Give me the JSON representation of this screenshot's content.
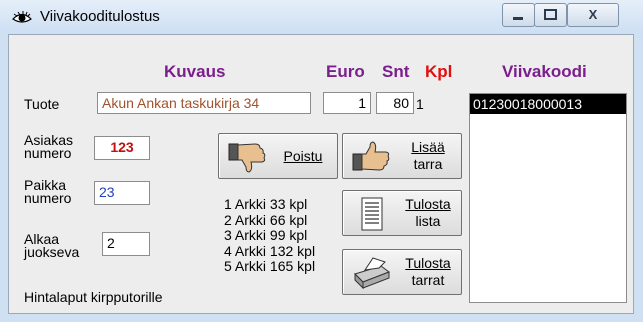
{
  "window": {
    "title": "Viivakooditulostus",
    "minimize_symbol": "▭",
    "maximize_symbol": "▢",
    "close_symbol": "X"
  },
  "headers": {
    "kuvaus": "Kuvaus",
    "euro": "Euro",
    "snt": "Snt",
    "kpl": "Kpl",
    "viivakoodi": "Viivakoodi"
  },
  "form": {
    "tuote_label": "Tuote",
    "tuote_value": "Akun Ankan taskukirja 34",
    "euro_value": "1",
    "snt_value": "80",
    "kpl_value": "1",
    "asiakas_label_1": "Asiakas",
    "asiakas_label_2": "numero",
    "asiakas_value": "123",
    "paikka_label_1": "Paikka",
    "paikka_label_2": "numero",
    "paikka_value": "23",
    "alkaa_label_1": "Alkaa",
    "alkaa_label_2": "juokseva",
    "alkaa_value": "2",
    "footer_text": "Hintalaput kirpputorille"
  },
  "buttons": {
    "poistu": "Poistu",
    "lisaa_1": "Lisää",
    "lisaa_2": "tarra",
    "tulosta_lista_1": "Tulosta",
    "tulosta_lista_2": "lista",
    "tulosta_tarrat_1": "Tulosta",
    "tulosta_tarrat_2": "tarrat"
  },
  "sheets": [
    "1 Arkki 33 kpl",
    "2 Arkki 66 kpl",
    "3 Arkki 99 kpl",
    "4 Arkki 132 kpl",
    "5 Arkki 165 kpl"
  ],
  "barcodes": [
    "01230018000013"
  ],
  "colors": {
    "header_purple": "#7a1f8c",
    "kpl_red": "#e01010",
    "asiakas_red": "#c01010",
    "paikka_blue": "#2040c0",
    "tuote_gray": "#a0522d"
  }
}
